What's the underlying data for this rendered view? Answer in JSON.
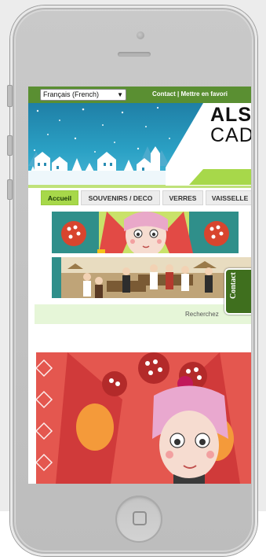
{
  "topbar": {
    "language": "Français (French)",
    "links": "Contact | Mettre en favori"
  },
  "logo": {
    "line1": "ALS",
    "line2": "CAD"
  },
  "nav": {
    "tabs": [
      "Accueil",
      "SOUVENIRS / DECO",
      "VERRES",
      "VAISSELLE"
    ],
    "active_index": 0
  },
  "search": {
    "placeholder": "Recherchez"
  },
  "contact_tab": {
    "label": "Contact"
  },
  "colors": {
    "topbar": "#5a8f32",
    "accent_lime": "#a7d84a",
    "contact_tab": "#3f6f1e",
    "header_sky": "#2aa0c4"
  }
}
